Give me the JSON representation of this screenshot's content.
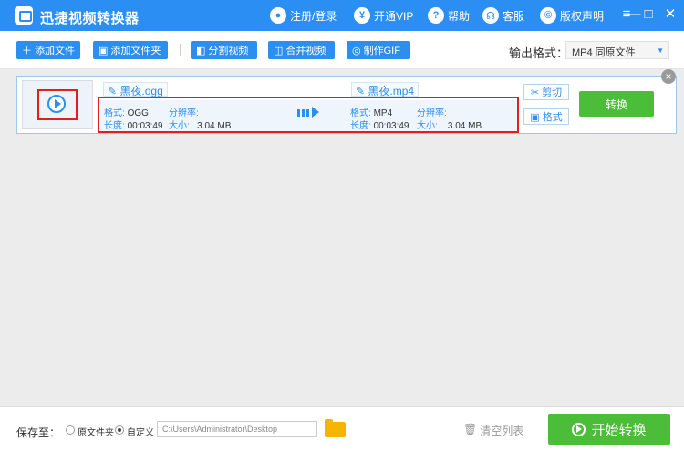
{
  "window": {
    "title": "迅捷视频转换器",
    "links": [
      {
        "label": "注册/登录",
        "icon": "user-icon"
      },
      {
        "label": "开通VIP",
        "icon": "vip-icon"
      },
      {
        "label": "帮助",
        "icon": "help-icon"
      },
      {
        "label": "客服",
        "icon": "headset-icon"
      },
      {
        "label": "版权声明",
        "icon": "copyright-icon"
      }
    ],
    "controls": {
      "menu": "≡",
      "minimize": "—",
      "maximize": "□",
      "close": "✕"
    }
  },
  "toolbar": {
    "buttons": [
      {
        "label": "添加文件",
        "icon": "plus-icon"
      },
      {
        "label": "添加文件夹",
        "icon": "folder-add-icon"
      },
      {
        "label": "分割视频",
        "icon": "split-icon"
      },
      {
        "label": "合并视频",
        "icon": "merge-icon"
      },
      {
        "label": "制作GIF",
        "icon": "gif-icon"
      }
    ],
    "output_format_label": "输出格式：",
    "output_format_value": "MP4  同原文件"
  },
  "file_item": {
    "source": {
      "name": "黑夜.ogg",
      "format_key": "格式:",
      "format": "OGG",
      "resolution_key": "分辨率:",
      "resolution": "",
      "duration_key": "长度:",
      "duration": "00:03:49",
      "size_key": "大小:",
      "size": "3.04 MB"
    },
    "target": {
      "name": "黑夜.mp4",
      "format_key": "格式:",
      "format": "MP4",
      "resolution_key": "分辨率:",
      "resolution": "",
      "duration_key": "长度:",
      "duration": "00:03:49",
      "size_key": "大小:",
      "size": "3.04 MB"
    },
    "cut_label": "剪切",
    "format_label": "格式",
    "convert_label": "转换"
  },
  "bottom": {
    "save_to_label": "保存至：",
    "option_original": "原文件夹",
    "option_custom": "自定义",
    "selected_option": "自定义",
    "path": "C:\\Users\\Administrator\\Desktop",
    "clear_list_label": "清空列表",
    "start_label": "开始转换"
  },
  "colors": {
    "accent": "#2a8ef2",
    "green": "#4cbd39",
    "highlight": "#e02020"
  }
}
